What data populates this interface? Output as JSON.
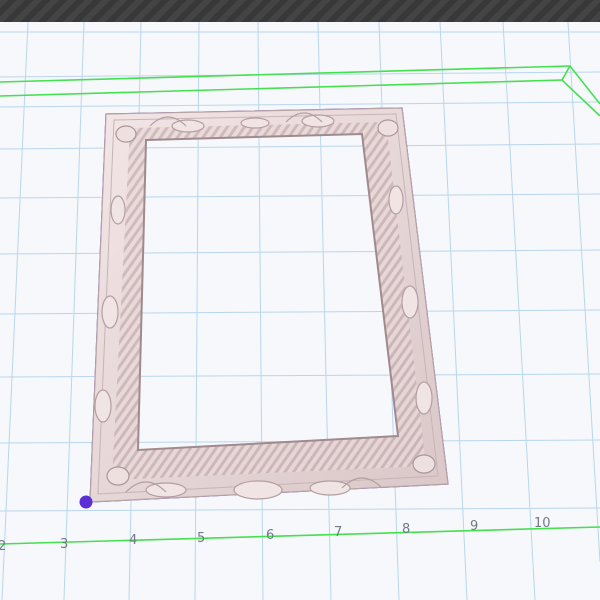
{
  "viewport": {
    "axis_ticks": [
      "2",
      "3",
      "4",
      "5",
      "6",
      "7",
      "8",
      "9",
      "10"
    ],
    "colors": {
      "grid": "#b9d6ec",
      "plate_outline": "#44e04e",
      "frame_fill": "#ead8d8",
      "frame_shadow": "#b7a3a5",
      "selection_outline": "#5b2fd6",
      "origin_point": "#5b2fd6"
    }
  },
  "scene": {
    "model": "ornate-picture-frame",
    "selected": true
  }
}
